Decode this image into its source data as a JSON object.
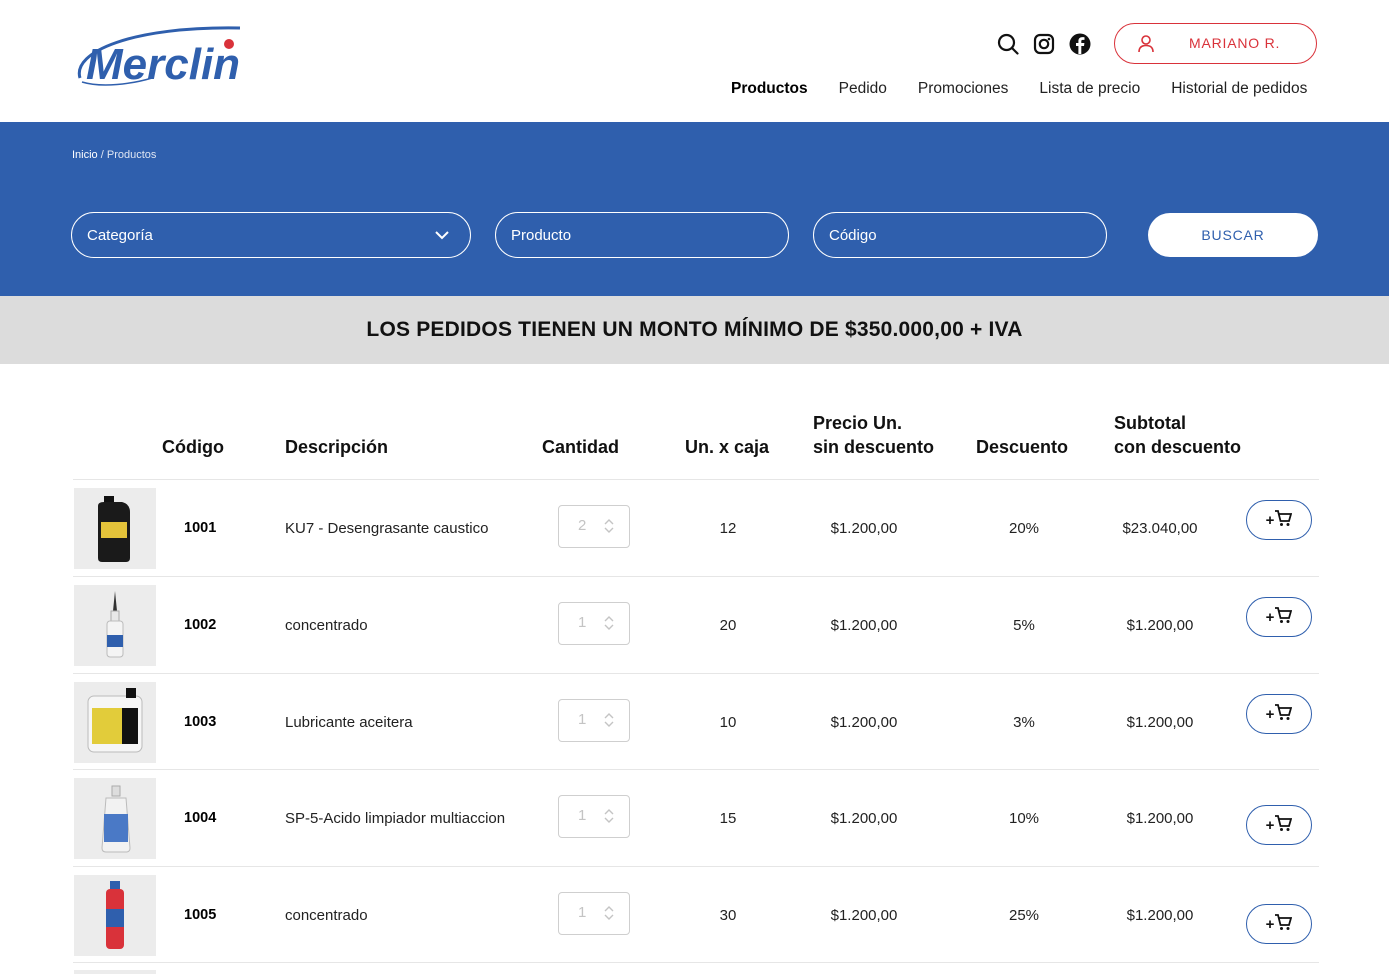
{
  "brand": {
    "name": "Merclin",
    "primary": "#2f5fad",
    "accent": "#d9323a"
  },
  "header": {
    "icons": [
      "search-icon",
      "instagram-icon",
      "facebook-icon"
    ],
    "user_label": "MARIANO R.",
    "nav": [
      {
        "label": "Productos",
        "active": true
      },
      {
        "label": "Pedido"
      },
      {
        "label": "Promociones"
      },
      {
        "label": "Lista de precio"
      },
      {
        "label": "Historial de pedidos"
      }
    ]
  },
  "breadcrumb": {
    "home": "Inicio",
    "separator": "/",
    "current": "Productos"
  },
  "filters": {
    "category_placeholder": "Categoría",
    "product_placeholder": "Producto",
    "code_placeholder": "Código",
    "search_label": "BUSCAR"
  },
  "notice": "LOS PEDIDOS TIENEN UN MONTO MÍNIMO DE $350.000,00 + IVA",
  "table": {
    "headers": {
      "code": "Código",
      "description": "Descripción",
      "quantity": "Cantidad",
      "units_per_box": "Un. x caja",
      "price_line1": "Precio Un.",
      "price_line2": "sin descuento",
      "discount": "Descuento",
      "subtotal_line1": "Subtotal",
      "subtotal_line2": "con descuento"
    },
    "add_label": "+",
    "rows": [
      {
        "code": "1001",
        "description": "KU7 - Desengrasante caustico",
        "quantity": "2",
        "units": "12",
        "price": "$1.200,00",
        "discount": "20%",
        "subtotal": "$23.040,00"
      },
      {
        "code": "1002",
        "description": "concentrado",
        "quantity": "1",
        "units": "20",
        "price": "$1.200,00",
        "discount": "5%",
        "subtotal": "$1.200,00"
      },
      {
        "code": "1003",
        "description": "Lubricante aceitera",
        "quantity": "1",
        "units": "10",
        "price": "$1.200,00",
        "discount": "3%",
        "subtotal": "$1.200,00"
      },
      {
        "code": "1004",
        "description": "SP-5-Acido limpiador multiaccion",
        "quantity": "1",
        "units": "15",
        "price": "$1.200,00",
        "discount": "10%",
        "subtotal": "$1.200,00"
      },
      {
        "code": "1005",
        "description": "concentrado",
        "quantity": "1",
        "units": "30",
        "price": "$1.200,00",
        "discount": "25%",
        "subtotal": "$1.200,00"
      }
    ]
  }
}
